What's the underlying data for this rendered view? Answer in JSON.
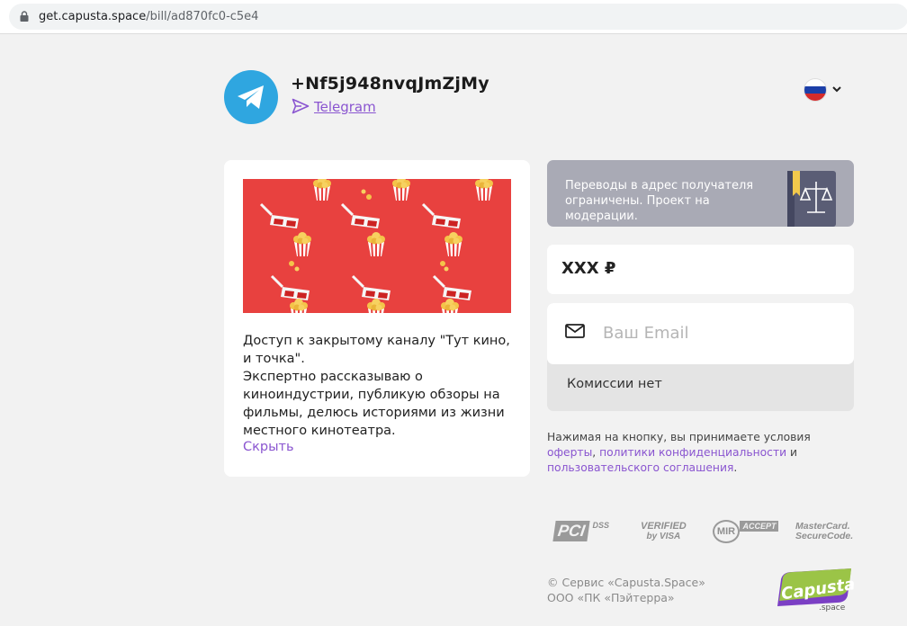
{
  "browser": {
    "url_host": "get.capusta.space",
    "url_path": "/bill/ad870fc0-c5e4"
  },
  "header": {
    "account_name": "+Nf5j948nvqJmZjMy",
    "channel_link": "Telegram",
    "language": "ru"
  },
  "description": {
    "lines": [
      "Доступ к закрытому каналу \"Тут кино, и точка\".",
      "Экспертно рассказываю о киноиндустрии, публикую обзоры на фильмы, делюсь историями из жизни местного кинотеатра."
    ],
    "hide_label": "Скрыть"
  },
  "payment": {
    "notice": "Переводы в адрес получателя ограничены. Проект на модерации.",
    "amount": "XXX ₽",
    "email_placeholder": "Ваш Email",
    "fee_text": "Комиссии нет"
  },
  "terms": {
    "prefix": "Нажимая на кнопку, вы принимаете условия ",
    "offer_link": "оферты",
    "sep1": ", ",
    "privacy_link": "политики конфиденциальности",
    "sep2": " и ",
    "agreement_link": "пользовательского соглашения",
    "suffix": "."
  },
  "payment_logos": {
    "pci": "PCI",
    "dss": "DSS",
    "verified_1": "VERIFIED",
    "verified_2": "by VISA",
    "mir": "MIR",
    "mir_accept": "ACCEPT",
    "mc_1": "MasterCard.",
    "mc_2": "SecureCode."
  },
  "footer": {
    "line1": "© Сервис «Capusta.Space»",
    "line2": "ООО «ПК «Пэйтерра»",
    "logo_text": "Capusta",
    "logo_sub": ".space"
  },
  "colors": {
    "accent": "#8a55d0",
    "telegram": "#2fa6e0",
    "notice_bg": "#a9aab5",
    "cover_bg": "#e8413f",
    "logo_green": "#9fd33a",
    "logo_purple": "#7b3fc4"
  },
  "icons": [
    "lock-icon",
    "telegram-icon",
    "send-icon",
    "flag-ru-icon",
    "chevron-down-icon",
    "law-book-icon",
    "mail-icon"
  ]
}
